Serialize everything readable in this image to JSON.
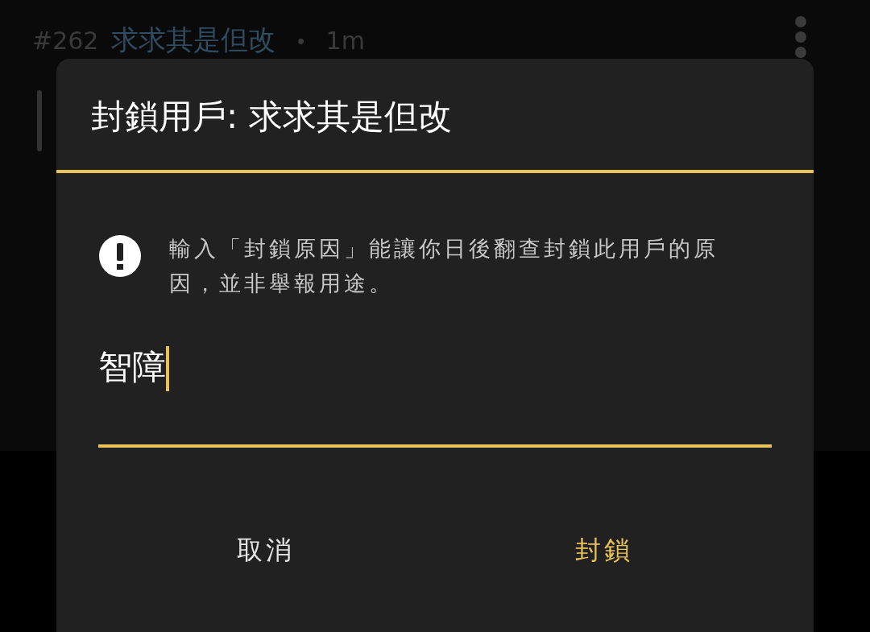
{
  "post": {
    "number": "#262",
    "author": "求求其是但改",
    "separator": "•",
    "time": "1m"
  },
  "dialog": {
    "title": "封鎖用戶: 求求其是但改",
    "notice": "輸入「封鎖原因」能讓你日後翻查封鎖此用戶的原因，並非舉報用途。",
    "reason": {
      "value": "智障",
      "focused": true
    },
    "buttons": [
      {
        "label": "取消",
        "kind": "cancel"
      },
      {
        "label": "封鎖",
        "kind": "confirm"
      }
    ]
  }
}
